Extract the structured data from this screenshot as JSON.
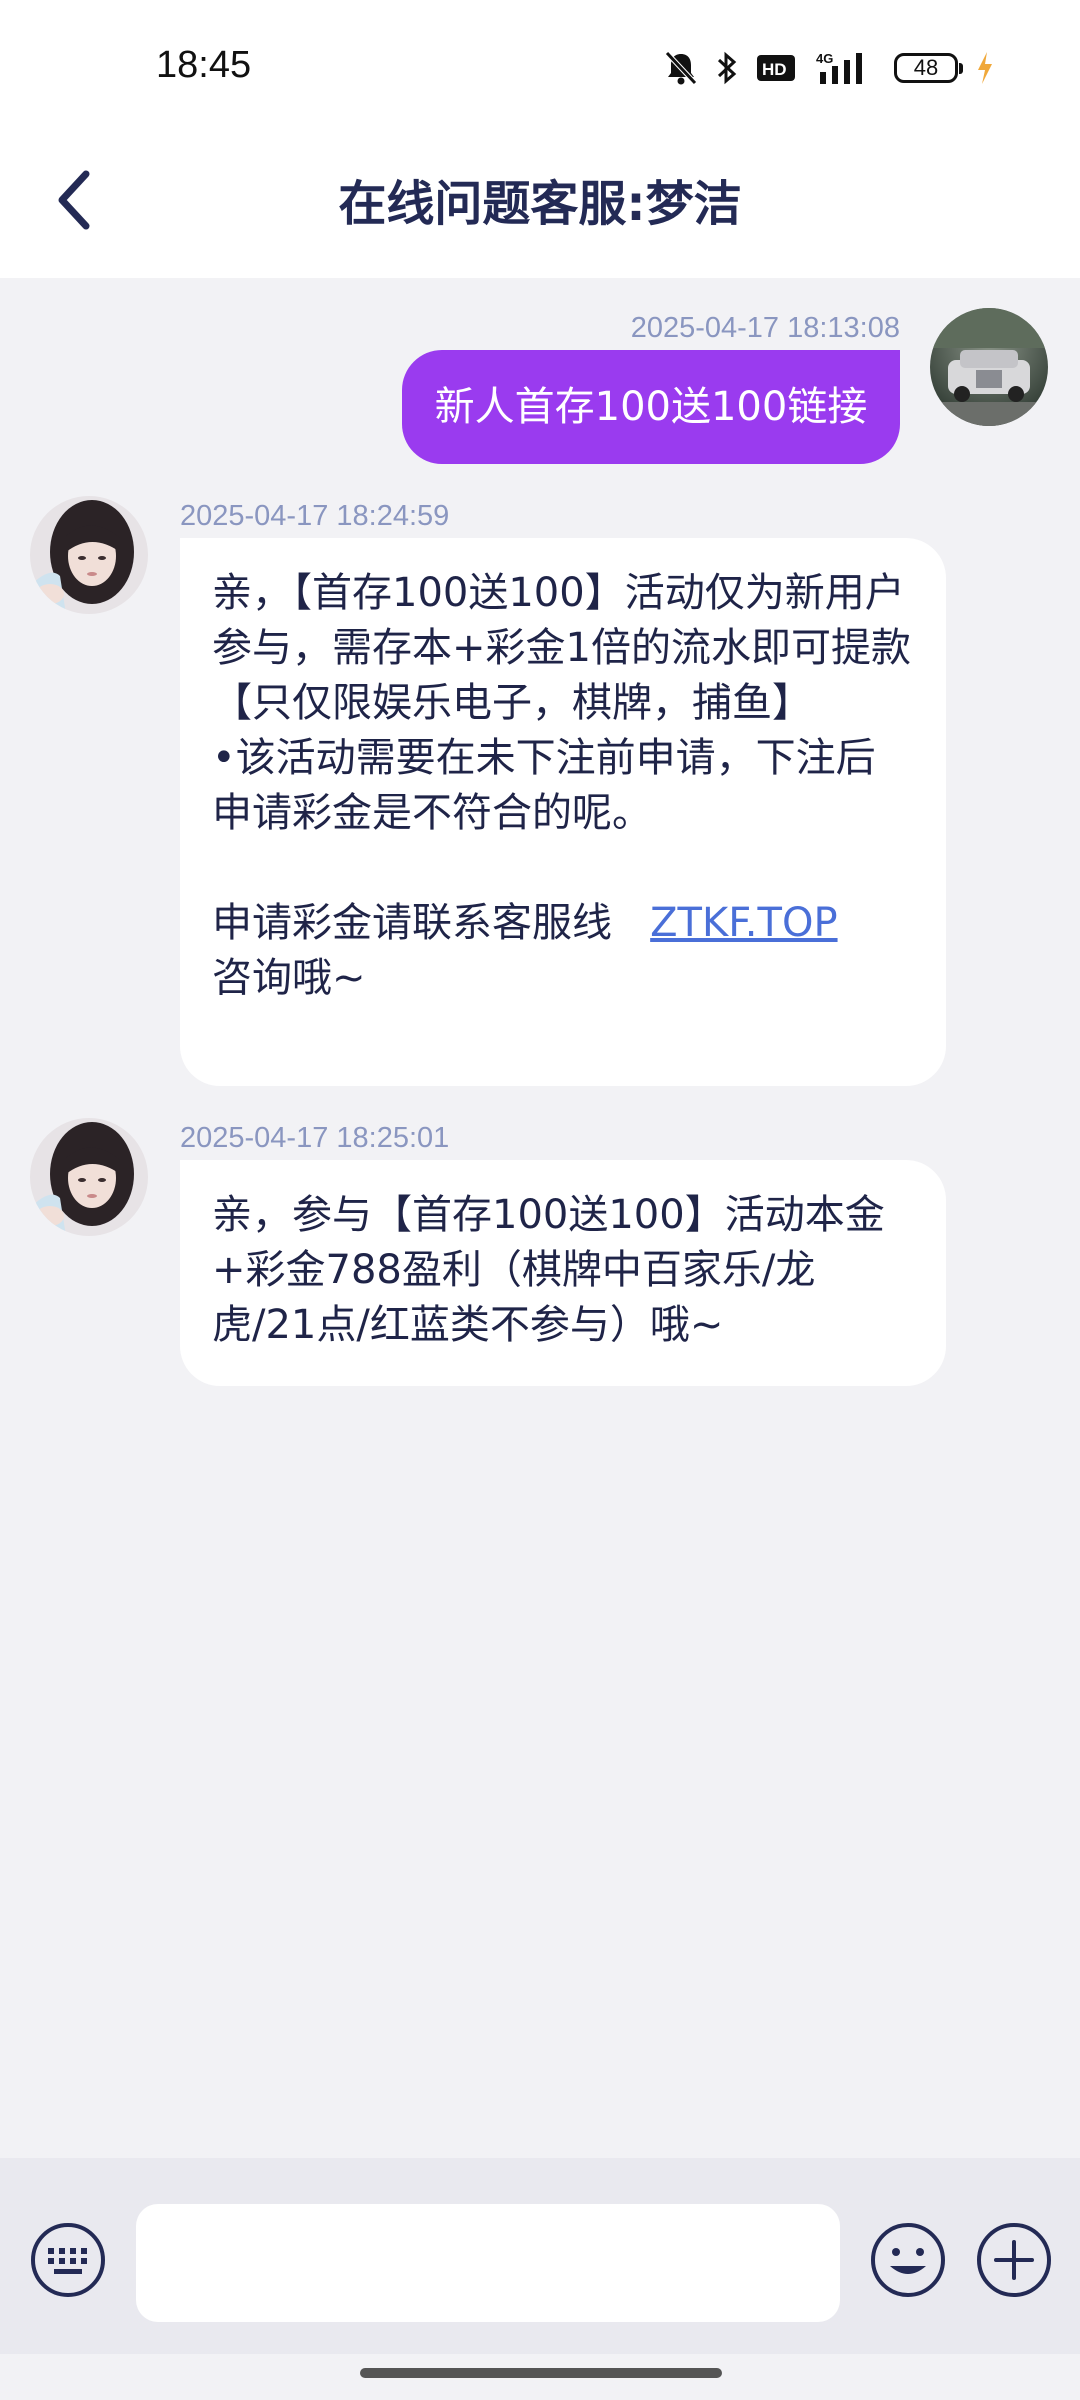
{
  "status_bar": {
    "time": "18:45",
    "battery_level": "48",
    "icons": [
      "mute-bell-icon",
      "bluetooth-icon",
      "hd-icon",
      "4g-signal-icon",
      "battery-icon",
      "charging-icon"
    ]
  },
  "header": {
    "title": "在线问题客服:梦洁",
    "back_icon": "chevron-left-icon"
  },
  "messages": [
    {
      "direction": "outgoing",
      "timestamp": "2025-04-17 18:13:08",
      "text": "新人首存100送100链接"
    },
    {
      "direction": "incoming",
      "timestamp": "2025-04-17 18:24:59",
      "line1": "亲，【首存100送100】活动仅为新用户参与，需存本+彩金1倍的流水即可提款【只仅限娱乐电子，棋牌，捕鱼】",
      "line2": "•该活动需要在未下注前申请，下注后申请彩金是不符合的呢。",
      "line3_prefix": "申请彩金请联系客服线",
      "link": "ZTKF.TOP",
      "line3_suffix": "咨询哦~"
    },
    {
      "direction": "incoming",
      "timestamp": "2025-04-17 18:25:01",
      "text": "亲，参与【首存100送100】活动本金+彩金788盈利（棋牌中百家乐/龙虎/21点/红蓝类不参与）哦~"
    }
  ],
  "input_bar": {
    "placeholder": "",
    "value": "",
    "keyboard_icon": "keyboard-icon",
    "emoji_icon": "emoji-icon",
    "add_icon": "plus-icon"
  },
  "colors": {
    "accent_bubble": "#9a3bef",
    "link": "#4a6fd8",
    "title": "#232a55",
    "background": "#f2f2f5"
  }
}
